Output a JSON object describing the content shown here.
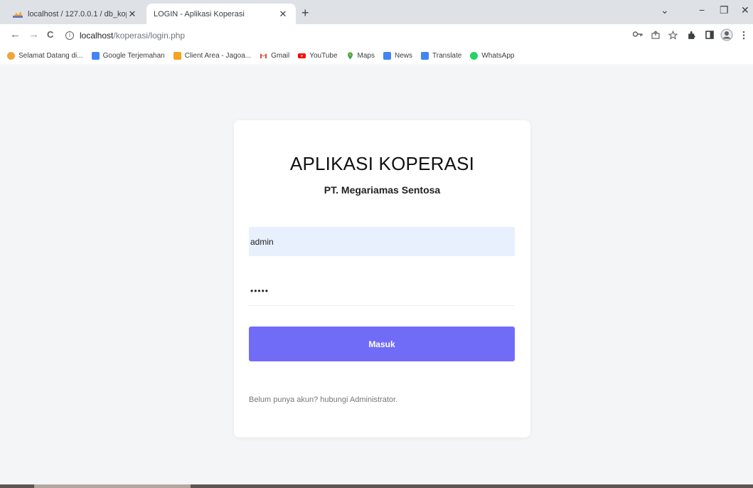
{
  "browser": {
    "tabs": [
      {
        "title": "localhost / 127.0.0.1 / db_koper...",
        "close": "✕",
        "active": false
      },
      {
        "title": "LOGIN - Aplikasi Koperasi",
        "close": "✕",
        "active": true
      }
    ],
    "new_tab": "+",
    "window_controls": {
      "tab_search": "⌄",
      "minimize": "−",
      "restore": "❐",
      "close": "✕"
    },
    "toolbar": {
      "back": "←",
      "forward": "→",
      "reload": "C",
      "info": "i",
      "url_host": "localhost",
      "url_path": "/koperasi/login.php",
      "icons": [
        "key-icon",
        "share-icon",
        "star-icon",
        "extensions-icon",
        "sidepanel-icon",
        "profile-icon",
        "menu-icon"
      ]
    },
    "bookmarks": [
      {
        "label": "Selamat Datang di...",
        "color": "#f2a43a"
      },
      {
        "label": "Google Terjemahan",
        "color": "#4285f4"
      },
      {
        "label": "Client Area - Jagoa...",
        "color": "#f4a31c"
      },
      {
        "label": "Gmail",
        "color": "#ea4335"
      },
      {
        "label": "YouTube",
        "color": "#ff0000"
      },
      {
        "label": "Maps",
        "color": "#34a853"
      },
      {
        "label": "News",
        "color": "#4285f4"
      },
      {
        "label": "Translate",
        "color": "#4285f4"
      },
      {
        "label": "WhatsApp",
        "color": "#25d366"
      }
    ]
  },
  "login": {
    "title": "APLIKASI KOPERASI",
    "subtitle": "PT. Megariamas Sentosa",
    "username_value": "admin",
    "password_value": "•••••",
    "submit_label": "Masuk",
    "footnote": "Belum punya akun? hubungi Administrator."
  },
  "colors": {
    "accent": "#716cf7",
    "autofill": "#e8f0fe",
    "page_bg": "#f4f5f7",
    "tabstrip": "#dee1e6"
  }
}
